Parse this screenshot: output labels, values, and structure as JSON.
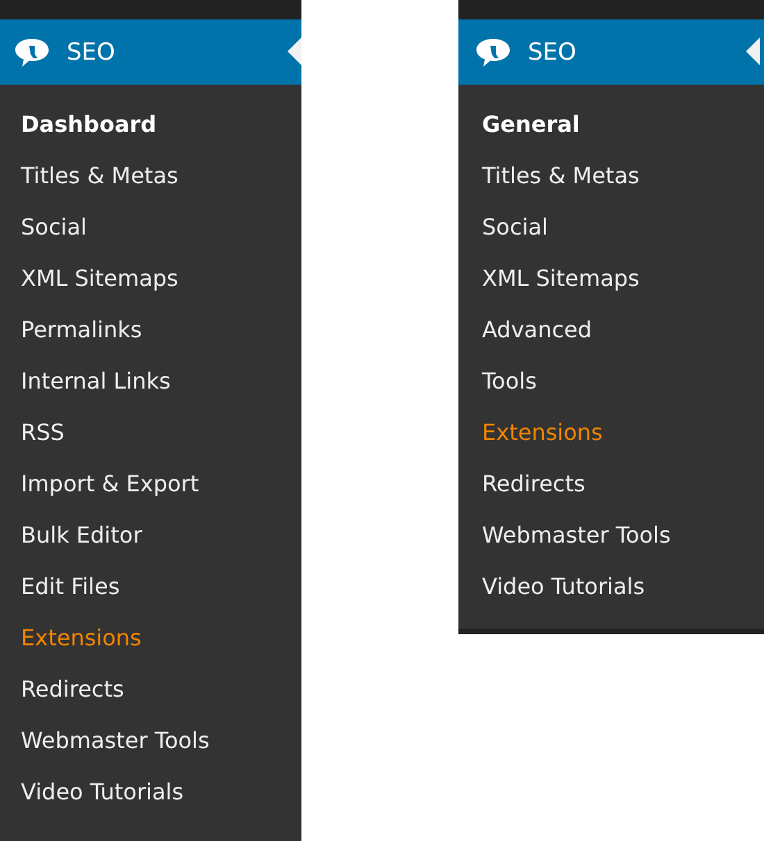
{
  "menus": [
    {
      "title": "SEO",
      "items": [
        {
          "label": "Dashboard",
          "selected": true,
          "highlighted": false
        },
        {
          "label": "Titles & Metas",
          "selected": false,
          "highlighted": false
        },
        {
          "label": "Social",
          "selected": false,
          "highlighted": false
        },
        {
          "label": "XML Sitemaps",
          "selected": false,
          "highlighted": false
        },
        {
          "label": "Permalinks",
          "selected": false,
          "highlighted": false
        },
        {
          "label": "Internal Links",
          "selected": false,
          "highlighted": false
        },
        {
          "label": "RSS",
          "selected": false,
          "highlighted": false
        },
        {
          "label": "Import & Export",
          "selected": false,
          "highlighted": false
        },
        {
          "label": "Bulk Editor",
          "selected": false,
          "highlighted": false
        },
        {
          "label": "Edit Files",
          "selected": false,
          "highlighted": false
        },
        {
          "label": "Extensions",
          "selected": false,
          "highlighted": true
        },
        {
          "label": "Redirects",
          "selected": false,
          "highlighted": false
        },
        {
          "label": "Webmaster Tools",
          "selected": false,
          "highlighted": false
        },
        {
          "label": "Video Tutorials",
          "selected": false,
          "highlighted": false
        }
      ]
    },
    {
      "title": "SEO",
      "items": [
        {
          "label": "General",
          "selected": true,
          "highlighted": false
        },
        {
          "label": "Titles & Metas",
          "selected": false,
          "highlighted": false
        },
        {
          "label": "Social",
          "selected": false,
          "highlighted": false
        },
        {
          "label": "XML Sitemaps",
          "selected": false,
          "highlighted": false
        },
        {
          "label": "Advanced",
          "selected": false,
          "highlighted": false
        },
        {
          "label": "Tools",
          "selected": false,
          "highlighted": false
        },
        {
          "label": "Extensions",
          "selected": false,
          "highlighted": true
        },
        {
          "label": "Redirects",
          "selected": false,
          "highlighted": false
        },
        {
          "label": "Webmaster Tools",
          "selected": false,
          "highlighted": false
        },
        {
          "label": "Video Tutorials",
          "selected": false,
          "highlighted": false
        }
      ]
    }
  ]
}
